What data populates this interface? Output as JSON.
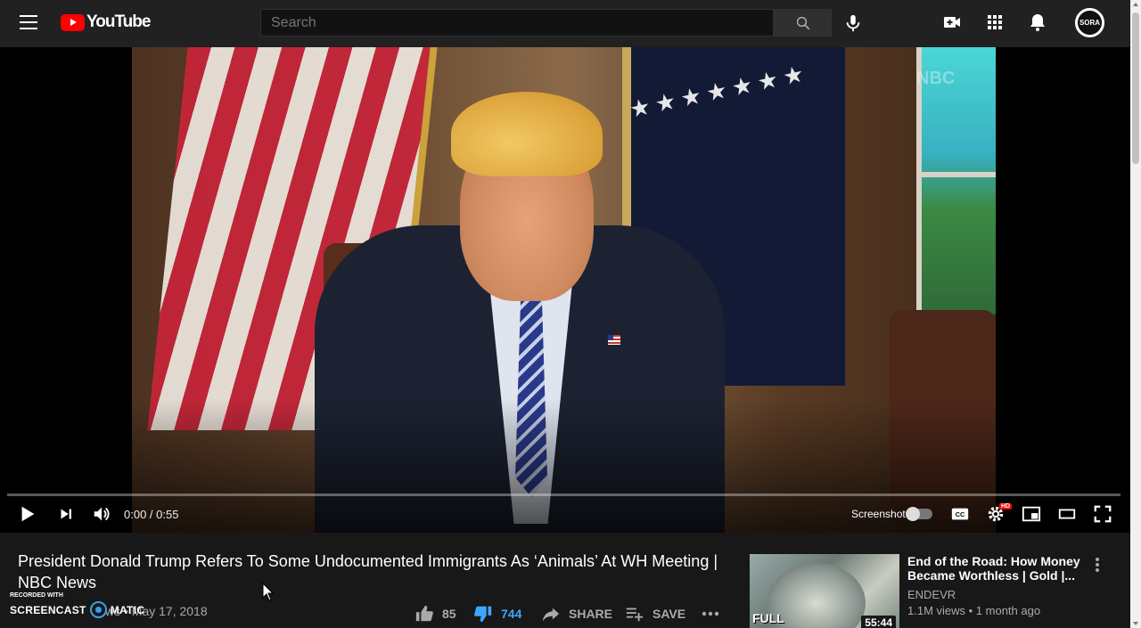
{
  "header": {
    "logo_text": "YouTube",
    "search": {
      "placeholder": "Search",
      "value": ""
    },
    "avatar_text": "SORA"
  },
  "player": {
    "time": "0:00 / 0:55",
    "progress_fraction": 0.0,
    "screenshot_label": "Screenshot",
    "hd_badge": "HD",
    "watermark_text": "NBC"
  },
  "video": {
    "title": "President Donald Trump Refers To Some Undocumented Immigrants As ‘Animals’ At WH Meeting | NBC News",
    "meta_partial": "ws • May 17, 2018",
    "likes": "85",
    "dislikes": "744",
    "share_label": "SHARE",
    "save_label": "SAVE"
  },
  "recorder_watermark": {
    "small": "RECORDED WITH",
    "big_left": "SCREENCAST",
    "big_right": "MATIC"
  },
  "recommended": [
    {
      "title": "End of the Road: How Money Became Worthless | Gold |...",
      "channel": "ENDEVR",
      "views": "1.1M views • 1 month ago",
      "duration": "55:44",
      "thumb_text": "FULL"
    }
  ],
  "colors": {
    "accent_red": "#ff0000",
    "dislike_blue": "#3ea6ff",
    "background": "#181818",
    "masthead": "#212121"
  },
  "icons": [
    "menu-icon",
    "youtube-logo-icon",
    "search-icon",
    "mic-icon",
    "create-video-icon",
    "apps-icon",
    "notifications-icon",
    "play-icon",
    "next-icon",
    "volume-icon",
    "captions-icon",
    "settings-icon",
    "miniplayer-icon",
    "theater-icon",
    "fullscreen-icon",
    "like-icon",
    "dislike-icon",
    "share-icon",
    "save-icon",
    "more-icon"
  ]
}
